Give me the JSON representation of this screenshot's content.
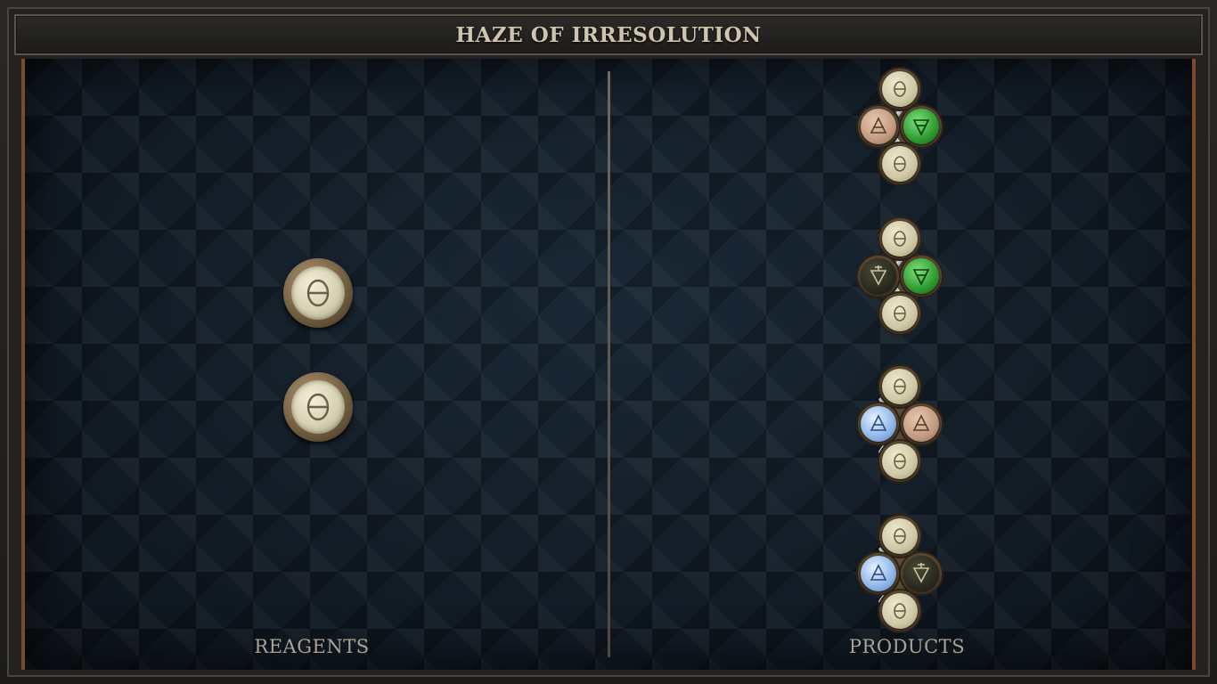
{
  "title": "HAZE OF IRRESOLUTION",
  "labels": {
    "reagents": "REAGENTS",
    "products": "PRODUCTS"
  },
  "reagents": [
    {
      "element": "salt",
      "icon": "salt-theta-icon"
    },
    {
      "element": "salt",
      "icon": "salt-theta-icon"
    }
  ],
  "products": [
    {
      "atoms": [
        "salt",
        "earth",
        "water",
        "salt"
      ]
    },
    {
      "atoms": [
        "salt",
        "dark-earth",
        "water",
        "salt"
      ]
    },
    {
      "atoms": [
        "salt",
        "air",
        "earth",
        "salt"
      ]
    },
    {
      "atoms": [
        "salt",
        "air",
        "dark-earth",
        "salt"
      ]
    }
  ],
  "colors": {
    "salt": "#d7d0b2",
    "earth": "#c29a80",
    "water": "#2f9a2f",
    "air": "#8eb4e8",
    "frame_accent": "#7a4a2a",
    "title_text": "#cfc4ad"
  }
}
